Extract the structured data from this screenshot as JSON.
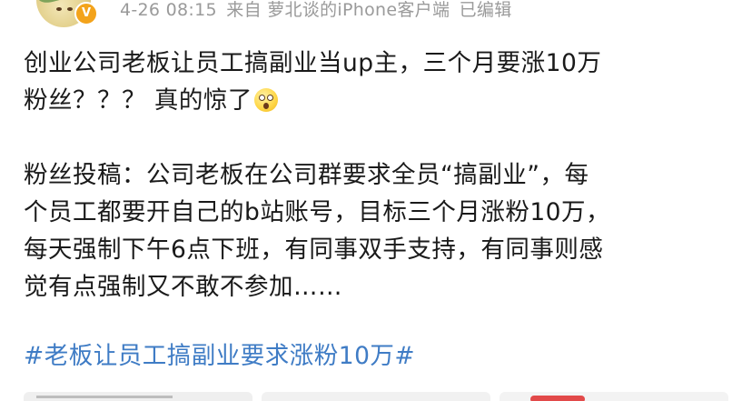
{
  "post": {
    "date": "4-26 08:15",
    "source": "来自 萝北谈的iPhone客户端",
    "edited": "已编辑",
    "badge_icon": "verified-v-badge",
    "line1": "创业公司老板让员工搞副业当up主，三个月要涨10万",
    "line2": "粉丝？？？ 真的惊了",
    "emoji_icon": "shocked-face-emoji",
    "line4": "粉丝投稿：公司老板在公司群要求全员“搞副业”，每",
    "line5": "个员工都要开自己的b站账号，目标三个月涨粉10万，",
    "line6": "每天强制下午6点下班，有同事双手支持，有同事则感",
    "line7": "觉有点强制又不敢不参加……",
    "hashtag": "#老板让员工搞副业要求涨粉10万#"
  },
  "colors": {
    "text": "#1a1a1a",
    "meta": "#9a9a9a",
    "hashtag": "#3f7cc5",
    "badge": "#f3a31b"
  }
}
